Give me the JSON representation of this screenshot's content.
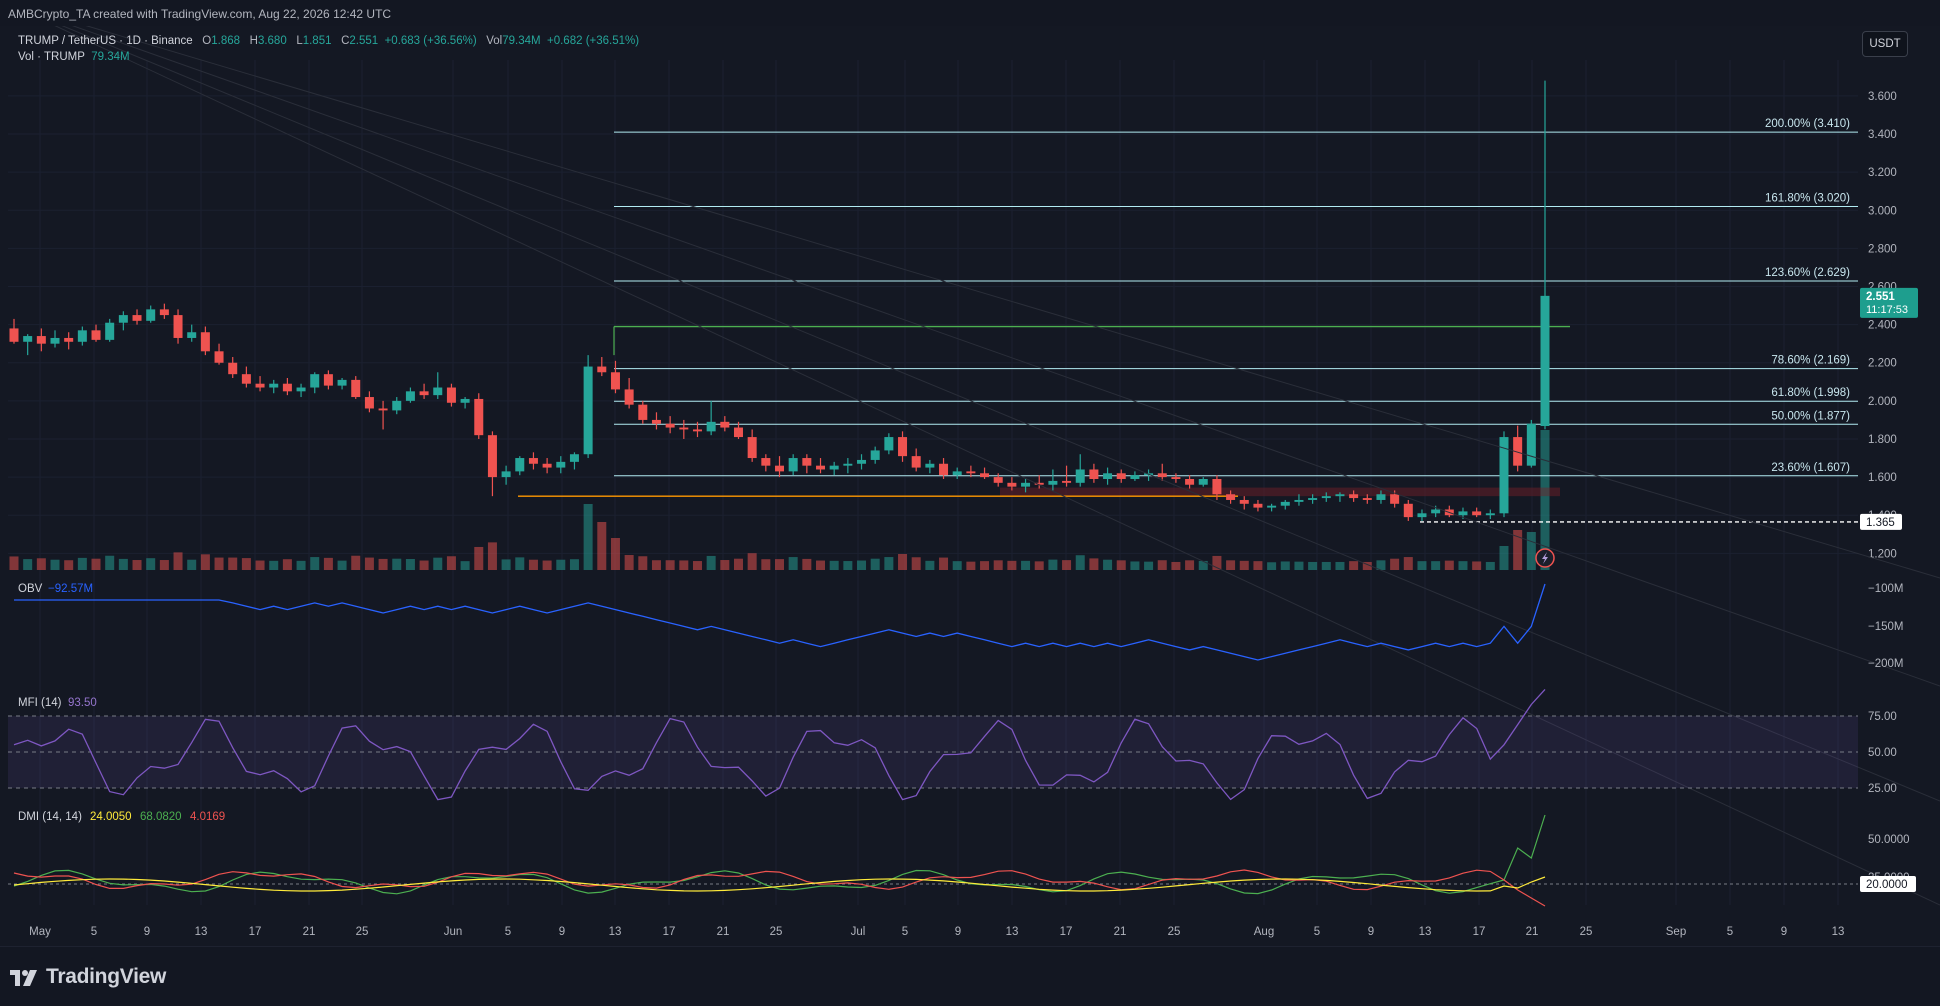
{
  "watermark_text": "AMBCrypto_TA created with TradingView.com, Aug 22, 2026 12:42 UTC",
  "currency_button": "USDT",
  "legend": {
    "symbol": "TRUMP / TetherUS · 1D · Binance",
    "o_label": "O",
    "o_val": "1.868",
    "h_label": "H",
    "h_val": "3.680",
    "l_label": "L",
    "l_val": "1.851",
    "c_label": "C",
    "c_val": "2.551",
    "change": "+0.683 (+36.56%)",
    "vol_label": "Vol",
    "vol_val": "79.34M",
    "vol_change": "+0.682 (+36.51%)",
    "vol2_label": "Vol · TRUMP",
    "vol2_val": "79.34M"
  },
  "price_axis_labels": [
    "3.600",
    "3.400",
    "3.200",
    "3.000",
    "2.800",
    "2.600",
    "2.400",
    "2.200",
    "2.000",
    "1.800",
    "1.600",
    "1.400",
    "1.200"
  ],
  "current_price_tag": {
    "price": "2.551",
    "countdown": "11:17:53",
    "color": "#1e9e8e"
  },
  "support_tag": "1.365",
  "fib_labels": [
    "200.00% (3.410)",
    "161.80% (3.020)",
    "123.60% (2.629)",
    "78.60% (2.169)",
    "61.80% (1.998)",
    "50.00% (1.877)",
    "23.60% (1.607)"
  ],
  "obv": {
    "label": "OBV",
    "value": "−92.57M",
    "axis": [
      "−100M",
      "−150M",
      "−200M"
    ]
  },
  "mfi": {
    "label": "MFI (14)",
    "value": "93.50",
    "axis": [
      "75.00",
      "50.00",
      "25.00"
    ]
  },
  "dmi": {
    "label": "DMI (14, 14)",
    "v1": "24.0050",
    "v2": "68.0820",
    "v3": "4.0169",
    "axis": [
      "50.0000",
      "25.0000"
    ],
    "tag": "20.0000"
  },
  "time_axis": [
    "May",
    "5",
    "9",
    "13",
    "17",
    "21",
    "25",
    "Jun",
    "5",
    "9",
    "13",
    "17",
    "21",
    "25",
    "Jul",
    "5",
    "9",
    "13",
    "17",
    "21",
    "25",
    "Aug",
    "5",
    "9",
    "13",
    "17",
    "21",
    "25",
    "Sep",
    "5",
    "9",
    "13"
  ],
  "brand": "TradingView",
  "colors": {
    "up": "#26a69a",
    "down": "#ef5350",
    "fib": "#b2ebf2",
    "obv": "#2962ff",
    "mfi": "#7e57c2",
    "adx": "#ffeb3b",
    "diplus": "#4caf50",
    "diminus": "#ef5350"
  },
  "chart_data": {
    "type": "candlestick",
    "title": "TRUMP / TetherUS · 1D · Binance",
    "ylim": [
      1.15,
      3.75
    ],
    "candles_ohlc": [
      [
        2.38,
        2.43,
        2.3,
        2.31
      ],
      [
        2.31,
        2.35,
        2.24,
        2.34
      ],
      [
        2.34,
        2.38,
        2.26,
        2.3
      ],
      [
        2.3,
        2.37,
        2.28,
        2.33
      ],
      [
        2.33,
        2.36,
        2.27,
        2.31
      ],
      [
        2.31,
        2.39,
        2.29,
        2.37
      ],
      [
        2.37,
        2.4,
        2.31,
        2.32
      ],
      [
        2.32,
        2.43,
        2.31,
        2.41
      ],
      [
        2.41,
        2.47,
        2.37,
        2.45
      ],
      [
        2.45,
        2.48,
        2.4,
        2.42
      ],
      [
        2.42,
        2.5,
        2.41,
        2.48
      ],
      [
        2.48,
        2.51,
        2.43,
        2.45
      ],
      [
        2.45,
        2.48,
        2.3,
        2.33
      ],
      [
        2.33,
        2.4,
        2.31,
        2.36
      ],
      [
        2.36,
        2.39,
        2.24,
        2.26
      ],
      [
        2.26,
        2.3,
        2.19,
        2.2
      ],
      [
        2.2,
        2.23,
        2.12,
        2.14
      ],
      [
        2.14,
        2.18,
        2.07,
        2.09
      ],
      [
        2.09,
        2.13,
        2.05,
        2.07
      ],
      [
        2.07,
        2.11,
        2.04,
        2.09
      ],
      [
        2.09,
        2.12,
        2.03,
        2.05
      ],
      [
        2.05,
        2.09,
        2.02,
        2.07
      ],
      [
        2.07,
        2.15,
        2.04,
        2.14
      ],
      [
        2.14,
        2.16,
        2.06,
        2.08
      ],
      [
        2.08,
        2.12,
        2.06,
        2.11
      ],
      [
        2.11,
        2.13,
        2.01,
        2.02
      ],
      [
        2.02,
        2.05,
        1.94,
        1.96
      ],
      [
        1.96,
        2.0,
        1.85,
        1.95
      ],
      [
        1.95,
        2.02,
        1.93,
        2.0
      ],
      [
        2.0,
        2.07,
        1.99,
        2.05
      ],
      [
        2.05,
        2.09,
        2.01,
        2.03
      ],
      [
        2.03,
        2.15,
        2.01,
        2.07
      ],
      [
        2.07,
        2.09,
        1.97,
        1.99
      ],
      [
        1.99,
        2.02,
        1.96,
        2.01
      ],
      [
        2.01,
        2.04,
        1.8,
        1.82
      ],
      [
        1.82,
        1.84,
        1.5,
        1.6
      ],
      [
        1.6,
        1.66,
        1.56,
        1.63
      ],
      [
        1.63,
        1.71,
        1.61,
        1.7
      ],
      [
        1.7,
        1.73,
        1.64,
        1.67
      ],
      [
        1.67,
        1.7,
        1.62,
        1.65
      ],
      [
        1.65,
        1.71,
        1.62,
        1.68
      ],
      [
        1.68,
        1.73,
        1.64,
        1.72
      ],
      [
        1.72,
        2.24,
        1.7,
        2.18
      ],
      [
        2.18,
        2.23,
        2.13,
        2.15
      ],
      [
        2.15,
        2.21,
        2.04,
        2.06
      ],
      [
        2.06,
        2.12,
        1.96,
        1.98
      ],
      [
        1.98,
        2.0,
        1.88,
        1.9
      ],
      [
        1.9,
        1.94,
        1.85,
        1.88
      ],
      [
        1.88,
        1.92,
        1.83,
        1.86
      ],
      [
        1.86,
        1.9,
        1.8,
        1.85
      ],
      [
        1.85,
        1.89,
        1.81,
        1.84
      ],
      [
        1.84,
        2.0,
        1.82,
        1.89
      ],
      [
        1.89,
        1.92,
        1.84,
        1.86
      ],
      [
        1.86,
        1.89,
        1.8,
        1.81
      ],
      [
        1.81,
        1.85,
        1.68,
        1.7
      ],
      [
        1.7,
        1.72,
        1.63,
        1.66
      ],
      [
        1.66,
        1.71,
        1.6,
        1.63
      ],
      [
        1.63,
        1.72,
        1.61,
        1.7
      ],
      [
        1.7,
        1.72,
        1.62,
        1.66
      ],
      [
        1.66,
        1.7,
        1.62,
        1.64
      ],
      [
        1.64,
        1.68,
        1.61,
        1.66
      ],
      [
        1.66,
        1.7,
        1.62,
        1.67
      ],
      [
        1.67,
        1.72,
        1.64,
        1.69
      ],
      [
        1.69,
        1.76,
        1.67,
        1.74
      ],
      [
        1.74,
        1.83,
        1.72,
        1.81
      ],
      [
        1.81,
        1.84,
        1.68,
        1.71
      ],
      [
        1.71,
        1.75,
        1.63,
        1.65
      ],
      [
        1.65,
        1.69,
        1.62,
        1.67
      ],
      [
        1.67,
        1.7,
        1.59,
        1.61
      ],
      [
        1.61,
        1.65,
        1.59,
        1.63
      ],
      [
        1.63,
        1.66,
        1.6,
        1.62
      ],
      [
        1.62,
        1.65,
        1.59,
        1.6
      ],
      [
        1.6,
        1.62,
        1.55,
        1.57
      ],
      [
        1.57,
        1.6,
        1.53,
        1.55
      ],
      [
        1.55,
        1.59,
        1.52,
        1.57
      ],
      [
        1.57,
        1.61,
        1.54,
        1.56
      ],
      [
        1.56,
        1.64,
        1.53,
        1.58
      ],
      [
        1.58,
        1.66,
        1.55,
        1.57
      ],
      [
        1.57,
        1.72,
        1.55,
        1.64
      ],
      [
        1.64,
        1.67,
        1.57,
        1.59
      ],
      [
        1.59,
        1.65,
        1.56,
        1.62
      ],
      [
        1.62,
        1.64,
        1.57,
        1.59
      ],
      [
        1.59,
        1.63,
        1.58,
        1.61
      ],
      [
        1.61,
        1.64,
        1.58,
        1.62
      ],
      [
        1.62,
        1.67,
        1.58,
        1.6
      ],
      [
        1.6,
        1.62,
        1.57,
        1.59
      ],
      [
        1.59,
        1.61,
        1.54,
        1.56
      ],
      [
        1.56,
        1.6,
        1.55,
        1.59
      ],
      [
        1.59,
        1.61,
        1.48,
        1.51
      ],
      [
        1.51,
        1.53,
        1.46,
        1.48
      ],
      [
        1.48,
        1.5,
        1.43,
        1.46
      ],
      [
        1.46,
        1.48,
        1.42,
        1.44
      ],
      [
        1.44,
        1.46,
        1.42,
        1.45
      ],
      [
        1.45,
        1.48,
        1.43,
        1.47
      ],
      [
        1.47,
        1.51,
        1.45,
        1.48
      ],
      [
        1.48,
        1.51,
        1.46,
        1.49
      ],
      [
        1.49,
        1.52,
        1.47,
        1.5
      ],
      [
        1.5,
        1.52,
        1.47,
        1.51
      ],
      [
        1.51,
        1.53,
        1.47,
        1.49
      ],
      [
        1.49,
        1.51,
        1.46,
        1.48
      ],
      [
        1.48,
        1.53,
        1.46,
        1.51
      ],
      [
        1.51,
        1.53,
        1.44,
        1.46
      ],
      [
        1.46,
        1.48,
        1.37,
        1.39
      ],
      [
        1.39,
        1.43,
        1.37,
        1.41
      ],
      [
        1.41,
        1.45,
        1.39,
        1.43
      ],
      [
        1.43,
        1.45,
        1.39,
        1.4
      ],
      [
        1.4,
        1.44,
        1.38,
        1.42
      ],
      [
        1.42,
        1.44,
        1.39,
        1.4
      ],
      [
        1.4,
        1.43,
        1.38,
        1.41
      ],
      [
        1.41,
        1.84,
        1.39,
        1.81
      ],
      [
        1.81,
        1.87,
        1.63,
        1.66
      ],
      [
        1.66,
        1.9,
        1.65,
        1.88
      ],
      [
        1.868,
        3.68,
        1.851,
        2.551
      ]
    ],
    "horizontal_levels": [
      {
        "price": 2.39,
        "color": "#4caf50"
      },
      {
        "price": 1.5,
        "color": "#ff9800"
      },
      {
        "price": 1.365,
        "color": "#ffffff",
        "style": "dashed"
      }
    ],
    "fib_levels": [
      3.41,
      3.02,
      2.629,
      2.169,
      1.998,
      1.877,
      1.607
    ]
  }
}
